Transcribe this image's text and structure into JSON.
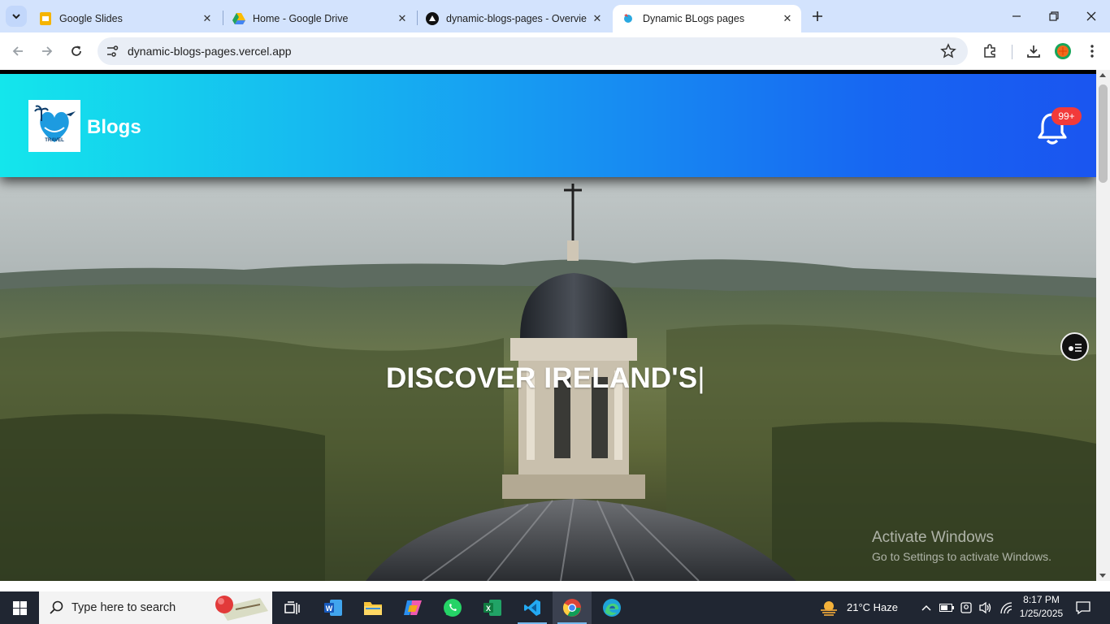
{
  "browser": {
    "tabs": [
      {
        "title": "Google Slides",
        "icon": "google-slides-icon"
      },
      {
        "title": "Home - Google Drive",
        "icon": "google-drive-icon"
      },
      {
        "title": "dynamic-blogs-pages - Overvie",
        "icon": "vercel-icon"
      },
      {
        "title": "Dynamic BLogs pages",
        "icon": "site-favicon",
        "active": true
      }
    ],
    "url": "dynamic-blogs-pages.vercel.app"
  },
  "page": {
    "brand": "Blogs",
    "logo_text": "TRAVEL",
    "notification_count": "99+",
    "hero_title": "DISCOVER IRELAND'S",
    "hero_cursor": "|"
  },
  "watermark": {
    "line1": "Activate Windows",
    "line2": "Go to Settings to activate Windows."
  },
  "taskbar": {
    "search_placeholder": "Type here to search",
    "weather": "21°C  Haze",
    "time": "8:17 PM",
    "date": "1/25/2025"
  },
  "colors": {
    "header_gradient_start": "#14e6ec",
    "header_gradient_end": "#1a55f0",
    "badge": "#f23a3a",
    "tab_strip": "#d3e3fd",
    "taskbar": "#202632"
  }
}
